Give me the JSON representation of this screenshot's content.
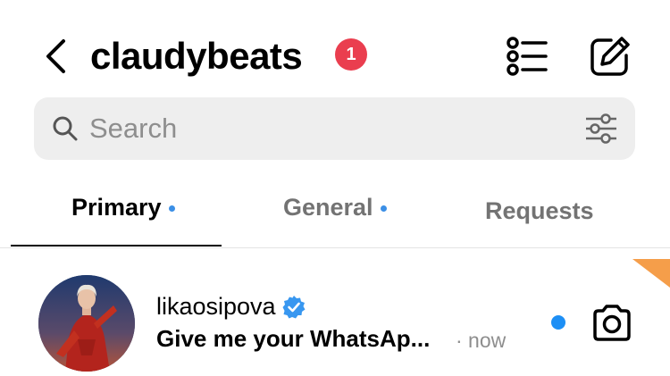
{
  "header": {
    "back_icon": "chevron-left-icon",
    "title": "claudybeats",
    "badge_count": "1",
    "list_icon": "list-icon",
    "compose_icon": "compose-icon"
  },
  "search": {
    "placeholder": "Search",
    "search_icon": "search-icon",
    "filter_icon": "filter-sliders-icon"
  },
  "tabs": [
    {
      "label": "Primary",
      "active": true,
      "has_dot": true
    },
    {
      "label": "General",
      "active": false,
      "has_dot": true
    },
    {
      "label": "Requests",
      "active": false,
      "has_dot": false
    }
  ],
  "threads": [
    {
      "username": "likaosipova",
      "verified": true,
      "message": "Give me your WhatsAp...",
      "time": "· now",
      "unread": true,
      "action_icon": "camera-icon"
    }
  ],
  "colors": {
    "badge": "#ea3e4f",
    "tab_dot": "#3b8fe6",
    "unread_dot": "#1d8ff5",
    "verified": "#3897f0",
    "corner_flag": "#f59e4a",
    "search_bg": "#eeeeee"
  }
}
